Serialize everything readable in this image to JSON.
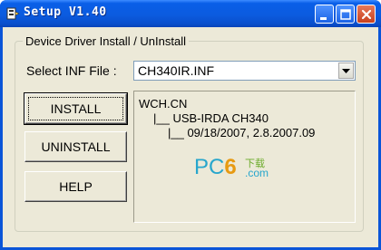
{
  "window": {
    "title": "Setup V1.40",
    "controls": {
      "minimize": "minimize-icon",
      "maximize": "maximize-icon",
      "close": "close-icon"
    }
  },
  "group": {
    "legend": "Device Driver Install / UnInstall"
  },
  "inf": {
    "label": "Select INF File :",
    "value": "CH340IR.INF"
  },
  "buttons": {
    "install": "INSTALL",
    "uninstall": "UNINSTALL",
    "help": "HELP"
  },
  "info": {
    "lines": [
      "WCH.CN",
      "|__ USB-IRDA CH340",
      "|__ 09/18/2007, 2.8.2007.09"
    ]
  },
  "watermark": {
    "main": "PC6",
    "sub_cn": "下载",
    "sub_domain": ".com"
  },
  "colors": {
    "titlebar": "#0a5fe8",
    "window_bg": "#ece9d8",
    "watermark_blue": "#27a6cc",
    "watermark_orange": "#e79a12"
  }
}
